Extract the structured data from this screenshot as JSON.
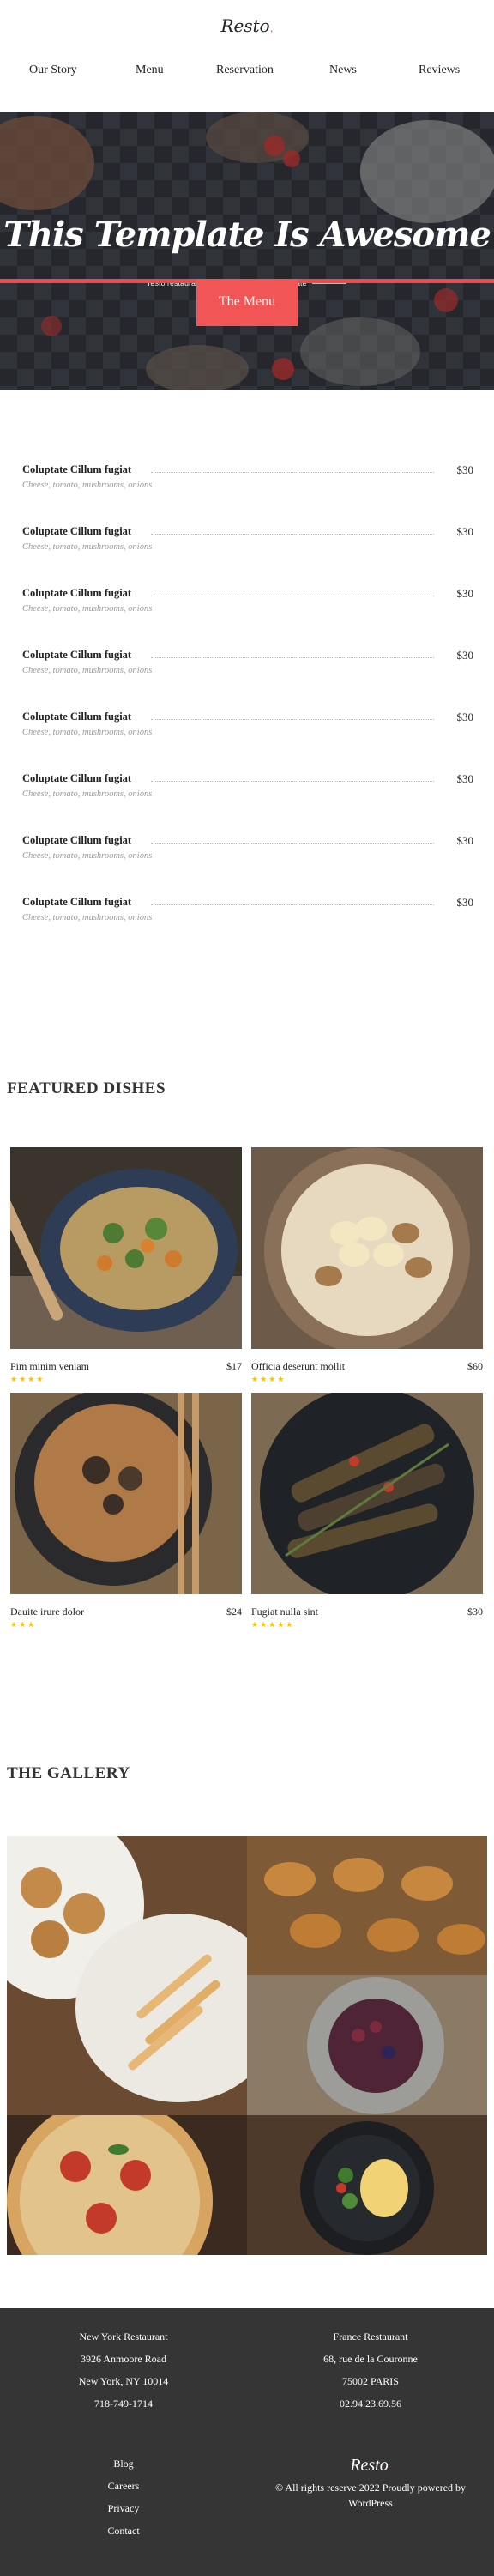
{
  "brand": {
    "logo_text": "Resto",
    "logo_dot": "."
  },
  "nav": {
    "items": [
      "Our Story",
      "Menu",
      "Reservation",
      "News",
      "Reviews"
    ]
  },
  "hero": {
    "title": "This Template Is Awesome",
    "subtitle": "resto restaurants home page website template"
  },
  "menu_section": {
    "tab_label": "The Menu",
    "items": [
      {
        "name": "Coluptate Cillum fugiat",
        "desc": "Cheese, tomato, mushrooms, onions",
        "price": "$30"
      },
      {
        "name": "Coluptate Cillum fugiat",
        "desc": "Cheese, tomato, mushrooms, onions",
        "price": "$30"
      },
      {
        "name": "Coluptate Cillum fugiat",
        "desc": "Cheese, tomato, mushrooms, onions",
        "price": "$30"
      },
      {
        "name": "Coluptate Cillum fugiat",
        "desc": "Cheese, tomato, mushrooms, onions",
        "price": "$30"
      },
      {
        "name": "Coluptate Cillum fugiat",
        "desc": "Cheese, tomato, mushrooms, onions",
        "price": "$30"
      },
      {
        "name": "Coluptate Cillum fugiat",
        "desc": "Cheese, tomato, mushrooms, onions",
        "price": "$30"
      },
      {
        "name": "Coluptate Cillum fugiat",
        "desc": "Cheese, tomato, mushrooms, onions",
        "price": "$30"
      },
      {
        "name": "Coluptate Cillum fugiat",
        "desc": "Cheese, tomato, mushrooms, onions",
        "price": "$30"
      }
    ]
  },
  "featured": {
    "title": "FEATURED DISHES",
    "dishes": [
      {
        "name": "Pim minim veniam",
        "price": "$17",
        "stars": 4
      },
      {
        "name": "Officia deserunt mollit",
        "price": "$60",
        "stars": 4
      },
      {
        "name": "Dauite irure dolor",
        "price": "$24",
        "stars": 3
      },
      {
        "name": "Fugiat nulla sint",
        "price": "$30",
        "stars": 5
      }
    ]
  },
  "gallery": {
    "title": "THE GALLERY"
  },
  "footer": {
    "ny": [
      "New York Restaurant",
      "3926 Anmoore Road",
      "New York, NY 10014",
      "718-749-1714"
    ],
    "fr": [
      "France Restaurant",
      "68, rue de la Couronne",
      "75002 PARIS",
      "02.94.23.69.56"
    ],
    "links": [
      "Blog",
      "Careers",
      "Privacy",
      "Contact"
    ],
    "logo_text": "Resto",
    "copyright": "© All rights reserve 2022 Proudly powered by WordPress"
  },
  "colors": {
    "accent": "#e84c4c",
    "star": "#f2c018",
    "footer_bg": "#353535"
  }
}
